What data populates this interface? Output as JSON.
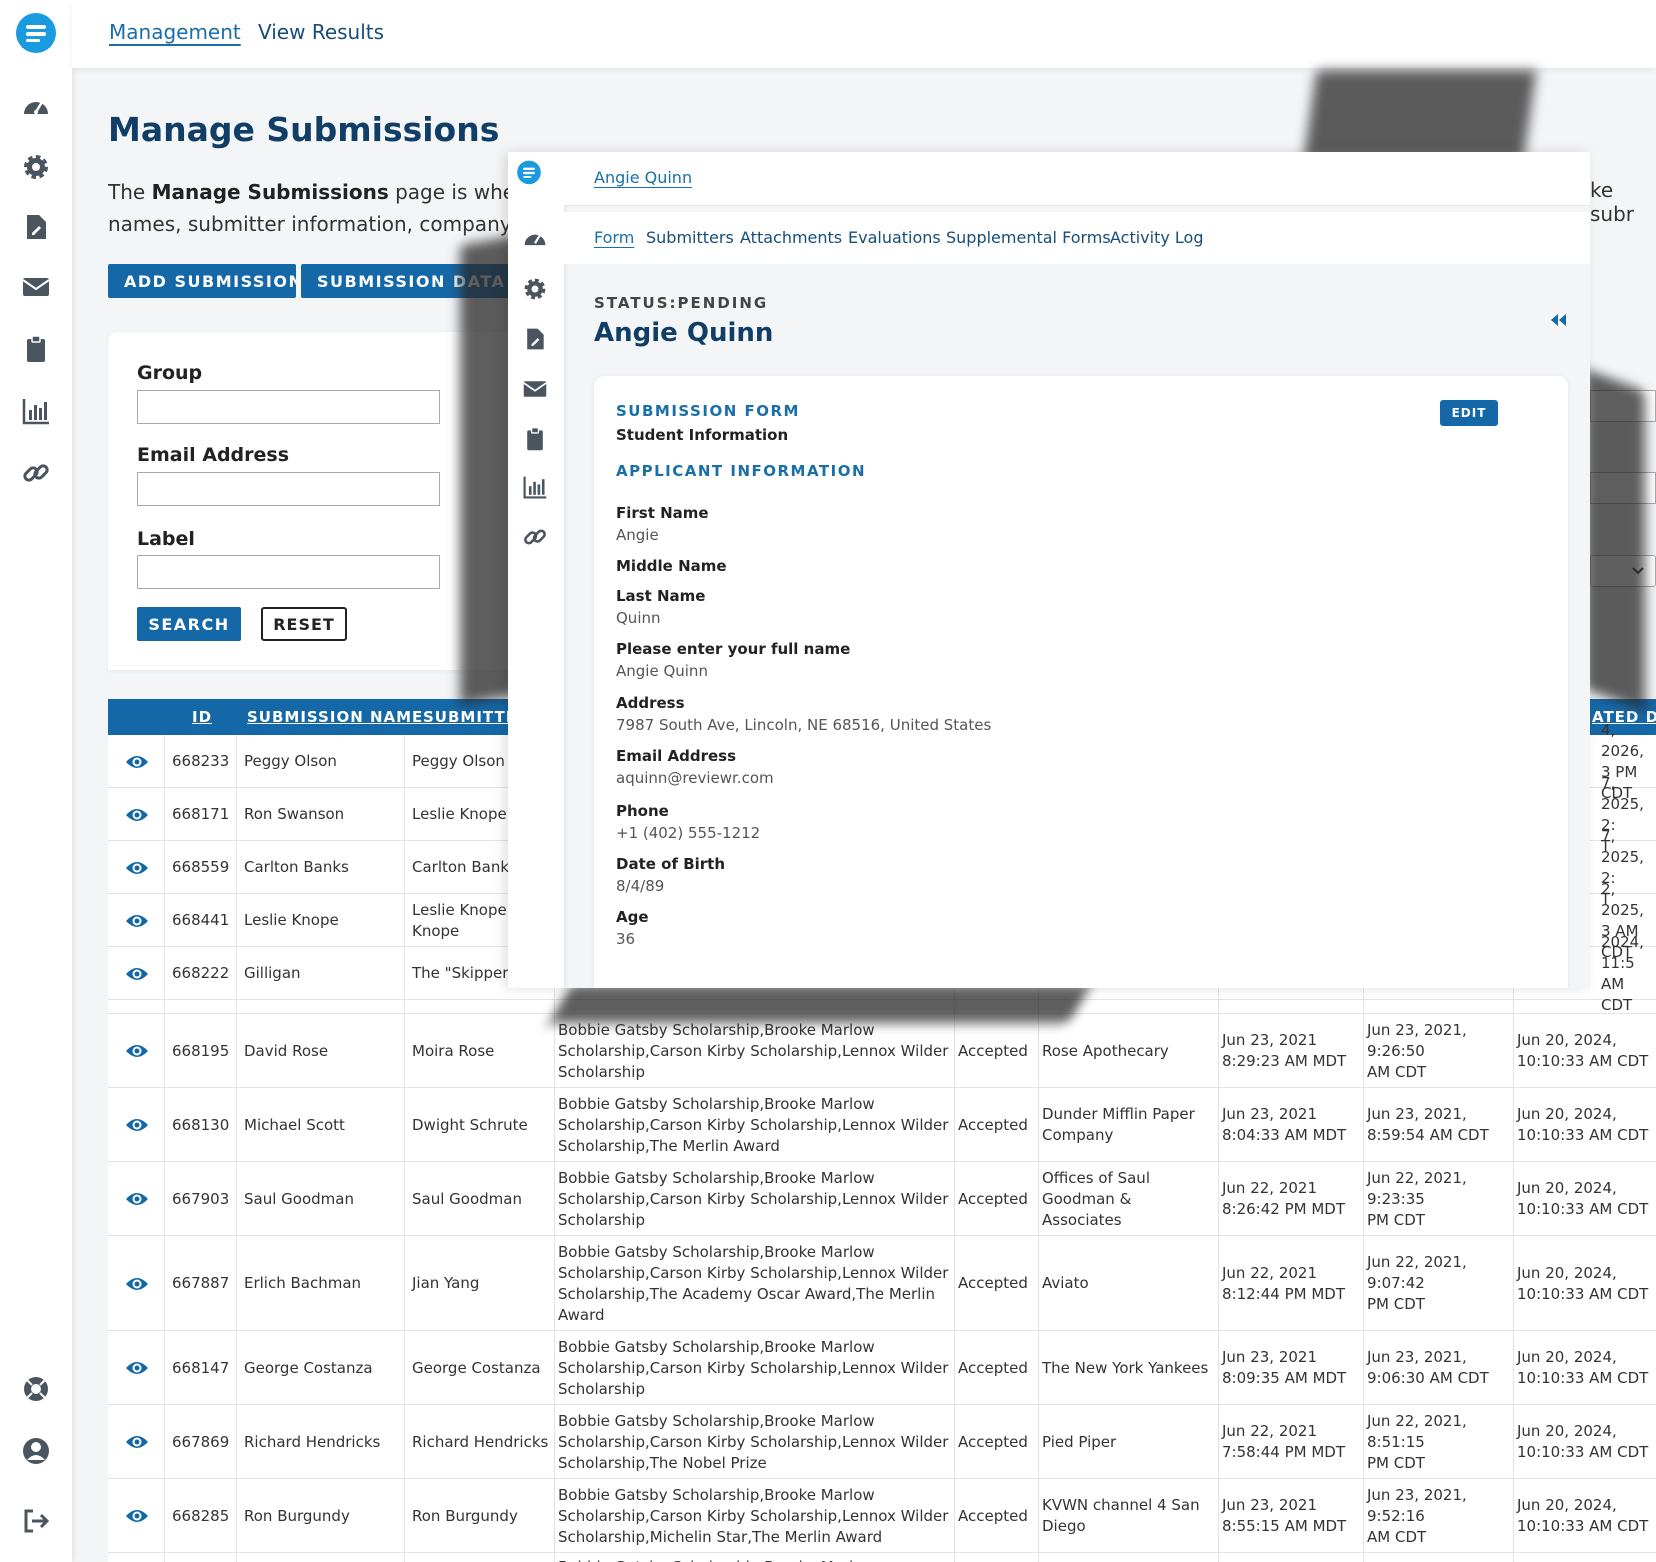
{
  "topnav": {
    "management": "Management",
    "view_results": "View Results"
  },
  "page": {
    "title": "Manage Submissions",
    "intro_pre": "The ",
    "intro_bold": "Manage Submissions",
    "intro_post": " page is where c",
    "intro_line2": "names, submitter information, company n",
    "right_fragment": "ke subr",
    "add_submission": "ADD SUBMISSION",
    "submission_data": "SUBMISSION DATA RE"
  },
  "search": {
    "group_label": "Group",
    "email_label": "Email Address",
    "label_label": "Label",
    "search_btn": "SEARCH",
    "reset_btn": "RESET"
  },
  "table": {
    "headers": {
      "id": "ID",
      "name": "SUBMISSION NAME",
      "submitter": "SUBMITTER",
      "updated": "ATED DA"
    },
    "top_rows": [
      {
        "id": "668233",
        "name": "Peggy Olson",
        "submitter": "Peggy Olson",
        "updated1": "4, 2026,",
        "updated2": "3 PM CDT"
      },
      {
        "id": "668171",
        "name": "Ron Swanson",
        "submitter": "Leslie Knope",
        "updated1": "7, 2025, 2:",
        "updated2": "T"
      },
      {
        "id": "668559",
        "name": "Carlton Banks",
        "submitter": "Carlton Bank",
        "updated1": "7, 2025, 2:",
        "updated2": "T"
      },
      {
        "id": "668441",
        "name": "Leslie Knope",
        "submitter": "Leslie Knope,l",
        "submitter2": "Knope",
        "updated1": "2, 2025,",
        "updated2": "3 AM CDT"
      },
      {
        "id": "668222",
        "name": "Gilligan",
        "submitter": "The \"Skipper\"",
        "updated1": "2024, 11:5",
        "updated2": "AM CDT"
      }
    ],
    "bottom_rows": [
      {
        "id": "668195",
        "name": "David Rose",
        "submitter": "Moira Rose",
        "awards": [
          "Bobbie Gatsby Scholarship,Brooke Marlow",
          "Scholarship,Carson Kirby Scholarship,Lennox Wilder",
          "Scholarship"
        ],
        "status": "Accepted",
        "company": [
          "Rose Apothecary"
        ],
        "submitted": [
          "Jun 23, 2021",
          "8:29:23 AM MDT"
        ],
        "created": [
          "Jun 23, 2021, 9:26:50",
          "AM CDT"
        ],
        "updated": [
          "Jun 20, 2024,",
          "10:10:33 AM CDT"
        ]
      },
      {
        "id": "668130",
        "name": "Michael Scott",
        "submitter": "Dwight Schrute",
        "awards": [
          "Bobbie Gatsby Scholarship,Brooke Marlow",
          "Scholarship,Carson Kirby Scholarship,Lennox Wilder",
          "Scholarship,The Merlin Award"
        ],
        "status": "Accepted",
        "company": [
          "Dunder Mifflin Paper",
          "Company"
        ],
        "submitted": [
          "Jun 23, 2021",
          "8:04:33 AM MDT"
        ],
        "created": [
          "Jun 23, 2021,",
          "8:59:54 AM CDT"
        ],
        "updated": [
          "Jun 20, 2024,",
          "10:10:33 AM CDT"
        ]
      },
      {
        "id": "667903",
        "name": "Saul Goodman",
        "submitter": "Saul Goodman",
        "awards": [
          "Bobbie Gatsby Scholarship,Brooke Marlow",
          "Scholarship,Carson Kirby Scholarship,Lennox Wilder",
          "Scholarship"
        ],
        "status": "Accepted",
        "company": [
          "Offices of Saul",
          "Goodman & Associates"
        ],
        "submitted": [
          "Jun 22, 2021",
          "8:26:42 PM MDT"
        ],
        "created": [
          "Jun 22, 2021, 9:23:35",
          "PM CDT"
        ],
        "updated": [
          "Jun 20, 2024,",
          "10:10:33 AM CDT"
        ]
      },
      {
        "id": "667887",
        "name": "Erlich Bachman",
        "submitter": "Jian Yang",
        "awards": [
          "Bobbie Gatsby Scholarship,Brooke Marlow",
          "Scholarship,Carson Kirby Scholarship,Lennox Wilder",
          "Scholarship,The Academy Oscar Award,The Merlin",
          "Award"
        ],
        "status": "Accepted",
        "company": [
          "Aviato"
        ],
        "submitted": [
          "Jun 22, 2021",
          "8:12:44 PM MDT"
        ],
        "created": [
          "Jun 22, 2021, 9:07:42",
          "PM CDT"
        ],
        "updated": [
          "Jun 20, 2024,",
          "10:10:33 AM CDT"
        ]
      },
      {
        "id": "668147",
        "name": "George Costanza",
        "submitter": "George Costanza",
        "awards": [
          "Bobbie Gatsby Scholarship,Brooke Marlow",
          "Scholarship,Carson Kirby Scholarship,Lennox Wilder",
          "Scholarship"
        ],
        "status": "Accepted",
        "company": [
          "The New York Yankees"
        ],
        "submitted": [
          "Jun 23, 2021",
          "8:09:35 AM MDT"
        ],
        "created": [
          "Jun 23, 2021,",
          "9:06:30 AM CDT"
        ],
        "updated": [
          "Jun 20, 2024,",
          "10:10:33 AM CDT"
        ]
      },
      {
        "id": "667869",
        "name": "Richard Hendricks",
        "submitter": "Richard Hendricks",
        "awards": [
          "Bobbie Gatsby Scholarship,Brooke Marlow",
          "Scholarship,Carson Kirby Scholarship,Lennox Wilder",
          "Scholarship,The Nobel Prize"
        ],
        "status": "Accepted",
        "company": [
          "Pied Piper"
        ],
        "submitted": [
          "Jun 22, 2021",
          "7:58:44 PM MDT"
        ],
        "created": [
          "Jun 22, 2021, 8:51:15",
          "PM CDT"
        ],
        "updated": [
          "Jun 20, 2024,",
          "10:10:33 AM CDT"
        ]
      },
      {
        "id": "668285",
        "name": "Ron Burgundy",
        "submitter": "Ron Burgundy",
        "awards": [
          "Bobbie Gatsby Scholarship,Brooke Marlow",
          "Scholarship,Carson Kirby Scholarship,Lennox Wilder",
          "Scholarship,Michelin Star,The Merlin Award"
        ],
        "status": "Accepted",
        "company": [
          "KVWN channel 4 San",
          "Diego"
        ],
        "submitted": [
          "Jun 23, 2021",
          "8:55:15 AM MDT"
        ],
        "created": [
          "Jun 23, 2021, 9:52:16",
          "AM CDT"
        ],
        "updated": [
          "Jun 20, 2024,",
          "10:10:33 AM CDT"
        ]
      }
    ],
    "partial_row_text": "Bobbie Gatsby Scholarship,Brooke Marlow"
  },
  "modal": {
    "breadcrumb": "Angie Quinn",
    "tabs": [
      "Form",
      "Submitters",
      "Attachments",
      "Evaluations",
      "Supplemental Forms",
      "Activity Log"
    ],
    "status": "STATUS:PENDING",
    "name": "Angie Quinn",
    "card": {
      "section": "SUBMISSION FORM",
      "subtitle": "Student Information",
      "edit": "EDIT",
      "applicant": "APPLICANT INFORMATION",
      "fields": [
        {
          "label": "First Name",
          "value": "Angie"
        },
        {
          "label": "Middle Name",
          "value": ""
        },
        {
          "label": "Last Name",
          "value": "Quinn"
        },
        {
          "label": "Please enter your full name",
          "value": "Angie Quinn"
        },
        {
          "label": "Address",
          "value": "7987 South Ave, Lincoln, NE 68516, United States"
        },
        {
          "label": "Email Address",
          "value": "aquinn@reviewr.com"
        },
        {
          "label": "Phone",
          "value": "+1 (402) 555-1212"
        },
        {
          "label": "Date of Birth",
          "value": "8/4/89"
        },
        {
          "label": "Age",
          "value": "36"
        }
      ]
    }
  },
  "colors": {
    "primary": "#1568a8",
    "title": "#103e66",
    "link": "#1a6fa8",
    "icon": "#2a3a4a"
  }
}
